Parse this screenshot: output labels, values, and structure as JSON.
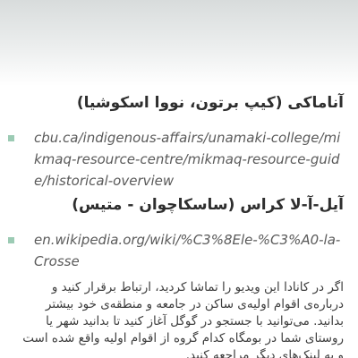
{
  "sections": [
    {
      "heading": "آناماکی (کیپ برتون، نووا اسکوشیا)",
      "link": "cbu.ca/indigenous-affairs/unamaki-college/mikmaq-resource-centre/mikmaq-resource-guide/historical-overview"
    },
    {
      "heading": "آیل-آ-لا کراس (ساسکاچوان - متیس)",
      "link": "en.wikipedia.org/wiki/%C3%8Ele-%C3%A0-la-Crosse"
    }
  ],
  "paragraph": "اگر در کانادا این ویدیو را تماشا کردید، ارتباط برقرار کنید و درباره‌ی اقوام اولیه‌ی ساکن در جامعه و منطقه‌ی خود بیشتر بدانید. می‌توانید با جستجو در گوگل آغاز کنید تا بدانید شهر یا روستای شما در بومگاه کدام گروه از اقوام اولیه واقع شده است و به لینک‌های دیگر مراجعه کنید."
}
